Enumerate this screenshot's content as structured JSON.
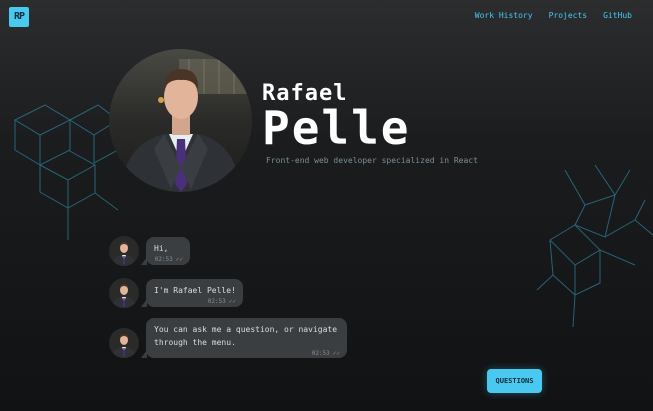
{
  "brand": {
    "logo_text": "RP",
    "accent": "#49c8f0"
  },
  "nav": {
    "items": [
      {
        "label": "Work History"
      },
      {
        "label": "Projects"
      },
      {
        "label": "GitHub"
      }
    ]
  },
  "hero": {
    "first_name": "Rafael",
    "last_name": "Pelle",
    "subtitle": "Front-end web developer specialized in React"
  },
  "chat": {
    "messages": [
      {
        "text": "Hi,",
        "time": "02:53"
      },
      {
        "text": "I'm Rafael Pelle!",
        "time": "02:53"
      },
      {
        "text": "You can ask me a question, or navigate\nthrough the menu.",
        "time": "02:53"
      }
    ],
    "read_icon": "double-check-icon"
  },
  "questions_button": {
    "label": "QUESTIONS"
  }
}
